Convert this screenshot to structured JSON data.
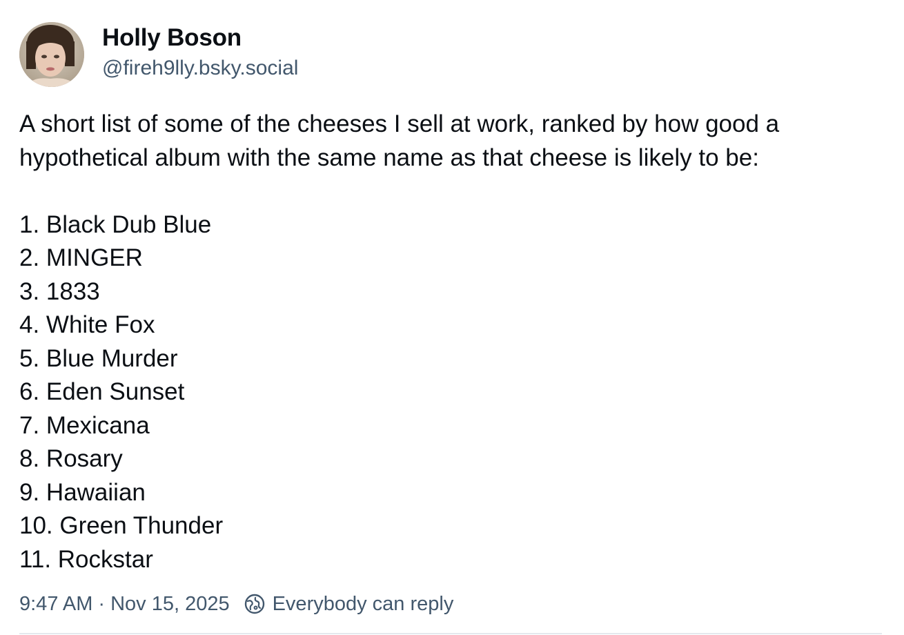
{
  "author": {
    "display_name": "Holly Boson",
    "handle": "@fireh9lly.bsky.social"
  },
  "post": {
    "intro": "A short list of some of the cheeses I sell at work, ranked by how good a hypothetical album with the same name as that cheese is likely to be:",
    "list": [
      "1. Black Dub Blue",
      "2. MINGER",
      "3. 1833",
      "4. White Fox",
      "5. Blue Murder",
      "6. Eden Sunset",
      "7. Mexicana",
      "8. Rosary",
      "9. Hawaiian",
      "10. Green Thunder",
      "11. Rockstar"
    ]
  },
  "meta": {
    "time": "9:47 AM",
    "separator": "·",
    "date": "Nov 15, 2025",
    "reply_setting": "Everybody can reply",
    "reply_icon": "globe-icon"
  },
  "colors": {
    "text": "#0b0f14",
    "secondary": "#42576c",
    "divider": "#e4e9ee"
  }
}
